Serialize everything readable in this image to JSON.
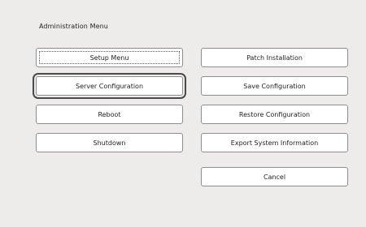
{
  "menu": {
    "title": "Administration Menu",
    "left_buttons": [
      {
        "label": "Setup Menu"
      },
      {
        "label": "Server Configuration"
      },
      {
        "label": "Reboot"
      },
      {
        "label": "Shutdown"
      }
    ],
    "right_buttons": [
      {
        "label": "Patch Installation"
      },
      {
        "label": "Save Configuration"
      },
      {
        "label": "Restore Configuration"
      },
      {
        "label": "Export System Information"
      },
      {
        "label": "Cancel"
      }
    ]
  },
  "colors": {
    "background": "#edecea",
    "button_fill": "#ffffff",
    "button_border": "#8e8e8e",
    "selection_outline": "#4a4a4a"
  }
}
